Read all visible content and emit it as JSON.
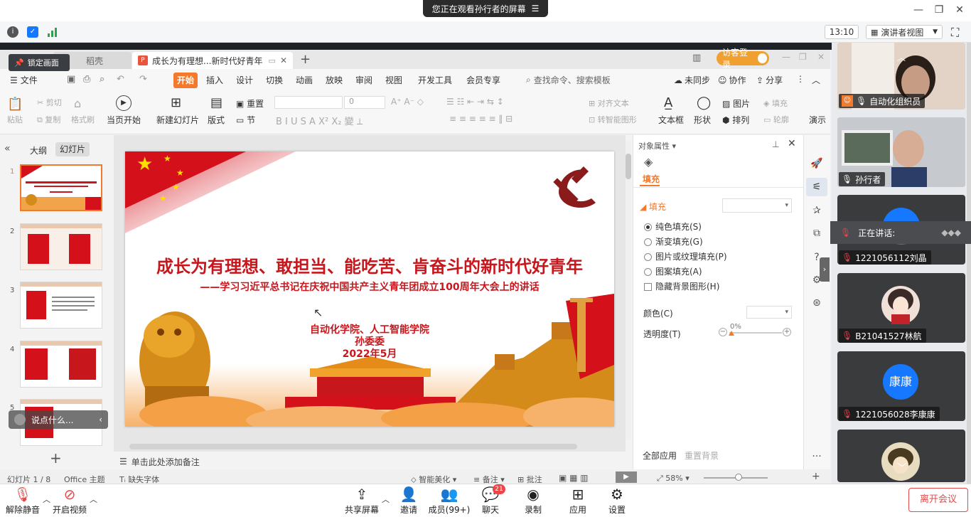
{
  "meeting": {
    "banner": "您正在观看孙行者的屏幕",
    "clock": "13:10",
    "view_mode": "演讲者视图"
  },
  "wps": {
    "lock_screen": "锁定画面",
    "tabs": [
      {
        "label": "稻壳"
      },
      {
        "label": "成长为有理想...新时代好青年"
      }
    ],
    "login_button": "访客登录",
    "menu": {
      "file": "文件",
      "items": [
        "开始",
        "插入",
        "设计",
        "切换",
        "动画",
        "放映",
        "审阅",
        "视图",
        "开发工具",
        "会员专享"
      ],
      "search": "查找命令、搜索模板",
      "sync": "未同步",
      "collab": "协作",
      "share": "分享"
    },
    "ribbon": {
      "paste": "粘贴",
      "cut": "剪切",
      "copy": "复制",
      "format_painter": "格式刷",
      "play_from_current": "当页开始",
      "new_slide": "新建幻灯片",
      "layout": "版式",
      "section": "节",
      "reset": "重置",
      "font_size": "0",
      "align_text": "对齐文本",
      "smartart": "转智能图形",
      "textbox": "文本框",
      "shape": "形状",
      "picture": "图片",
      "fill": "填充",
      "arrange": "排列",
      "outline": "轮廓",
      "presenter": "演示"
    },
    "left_panel": {
      "tab_outline": "大纲",
      "tab_slides": "幻灯片",
      "slide_numbers": [
        "1",
        "2",
        "3",
        "4",
        "5"
      ],
      "chat_placeholder": "说点什么..."
    },
    "slide": {
      "title": "成长为有理想、敢担当、能吃苦、肯奋斗的新时代好青年",
      "subtitle": "——学习习近平总书记在庆祝中国共产主义青年团成立100周年大会上的讲话",
      "org": "自动化学院、人工智能学院",
      "author": "孙委委",
      "date": "2022年5月"
    },
    "notes_placeholder": "单击此处添加备注",
    "properties": {
      "header": "对象属性",
      "tab_fill": "填充",
      "section_fill": "填充",
      "options": [
        {
          "label": "纯色填充(S)",
          "selected": true
        },
        {
          "label": "渐变填充(G)",
          "selected": false
        },
        {
          "label": "图片或纹理填充(P)",
          "selected": false
        },
        {
          "label": "图案填充(A)",
          "selected": false
        }
      ],
      "hide_bg": "隐藏背景图形(H)",
      "color_label": "颜色(C)",
      "transparency_label": "透明度(T)",
      "transparency_value": "0%",
      "apply_all": "全部应用",
      "reset_bg": "重置背景"
    },
    "status": {
      "slide_count": "幻灯片 1 / 8",
      "theme": "Office 主题",
      "missing_font": "缺失字体",
      "beautify": "智能美化",
      "notes": "备注",
      "comments": "批注",
      "zoom": "58%"
    }
  },
  "participants": [
    {
      "name": "自动化组织员",
      "mic": "on"
    },
    {
      "name": "孙行者",
      "mic": "on"
    },
    {
      "name": "1221056112刘晶",
      "mic": "off"
    },
    {
      "name": "B21041527林航",
      "mic": "off"
    },
    {
      "name": "1221056028李康康",
      "mic": "off",
      "avatar_text": "康康"
    }
  ],
  "speaking_label": "正在讲话:",
  "toolbar": {
    "unmute": "解除静音",
    "start_video": "开启视频",
    "share_screen": "共享屏幕",
    "invite": "邀请",
    "members": "成员(99+)",
    "chat": "聊天",
    "chat_badge": "21",
    "record": "录制",
    "apps": "应用",
    "settings": "设置",
    "leave": "离开会议"
  },
  "colors": {
    "accent_orange": "#f37a2c",
    "slide_red": "#c8161d",
    "leave_red": "#e24b4b",
    "avatar_blue": "#1677ff"
  }
}
